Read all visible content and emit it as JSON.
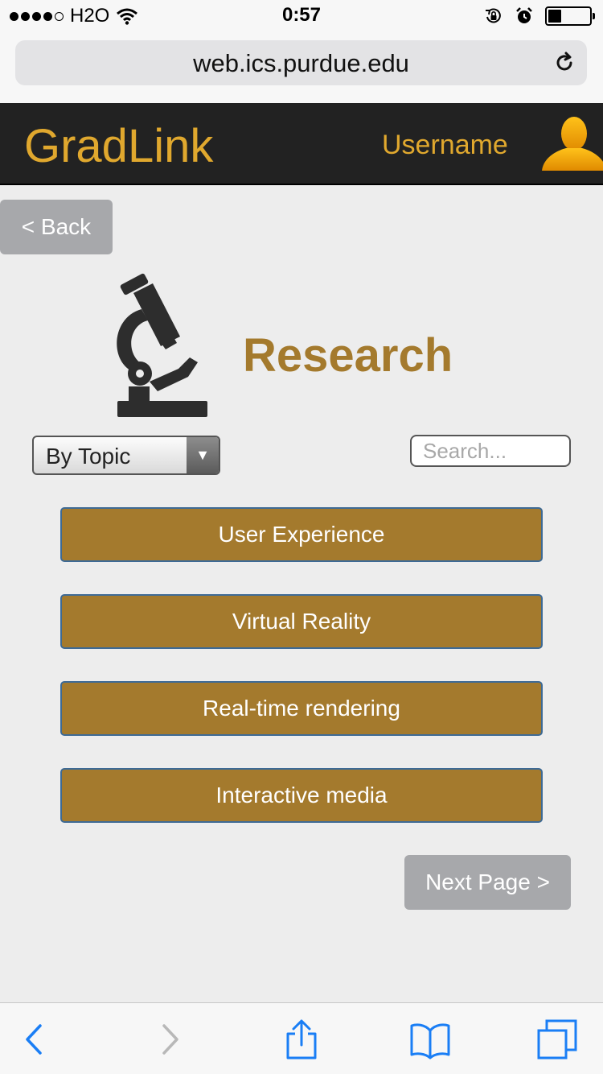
{
  "status_bar": {
    "carrier": "H2O",
    "time": "0:57"
  },
  "browser": {
    "url": "web.ics.purdue.edu"
  },
  "header": {
    "app_name": "GradLink",
    "username": "Username"
  },
  "nav": {
    "back_label": "< Back",
    "next_label": "Next Page >"
  },
  "section": {
    "title": "Research"
  },
  "filter": {
    "selected": "By Topic",
    "search_placeholder": "Search..."
  },
  "topics": [
    {
      "label": "User Experience"
    },
    {
      "label": "Virtual Reality"
    },
    {
      "label": "Real-time rendering"
    },
    {
      "label": "Interactive media"
    }
  ],
  "colors": {
    "brand_gold": "#e0a82e",
    "topic_button": "#a47a2d",
    "header_bg": "#222222",
    "nav_button": "#a7a8ab",
    "ios_blue": "#1a7ef5"
  },
  "icons": {
    "app": "microscope-icon",
    "user": "user-avatar-icon",
    "reload": "reload-icon",
    "toolbar": [
      "back-arrow-icon",
      "forward-arrow-icon",
      "share-icon",
      "bookmarks-icon",
      "tabs-icon"
    ]
  }
}
